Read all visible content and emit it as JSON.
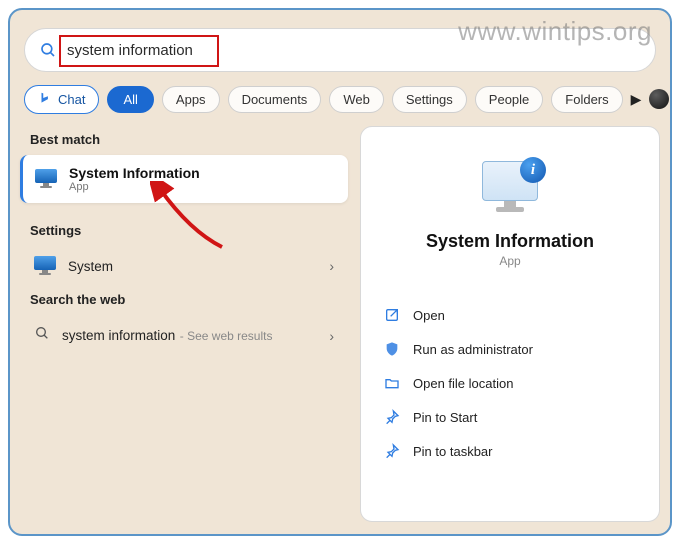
{
  "watermark": "www.wintips.org",
  "search": {
    "value": "system information"
  },
  "tabs": {
    "chat": "Chat",
    "all": "All",
    "apps": "Apps",
    "documents": "Documents",
    "web": "Web",
    "settings": "Settings",
    "people": "People",
    "folders": "Folders"
  },
  "left": {
    "best_match_label": "Best match",
    "best_match": {
      "title": "System Information",
      "subtitle": "App"
    },
    "settings_label": "Settings",
    "settings_item": {
      "title": "System"
    },
    "web_label": "Search the web",
    "web_item": {
      "title": "system information",
      "suffix": "See web results"
    }
  },
  "right": {
    "app_name": "System Information",
    "app_type": "App",
    "actions": {
      "open": "Open",
      "run_admin": "Run as administrator",
      "open_loc": "Open file location",
      "pin_start": "Pin to Start",
      "pin_taskbar": "Pin to taskbar"
    }
  }
}
